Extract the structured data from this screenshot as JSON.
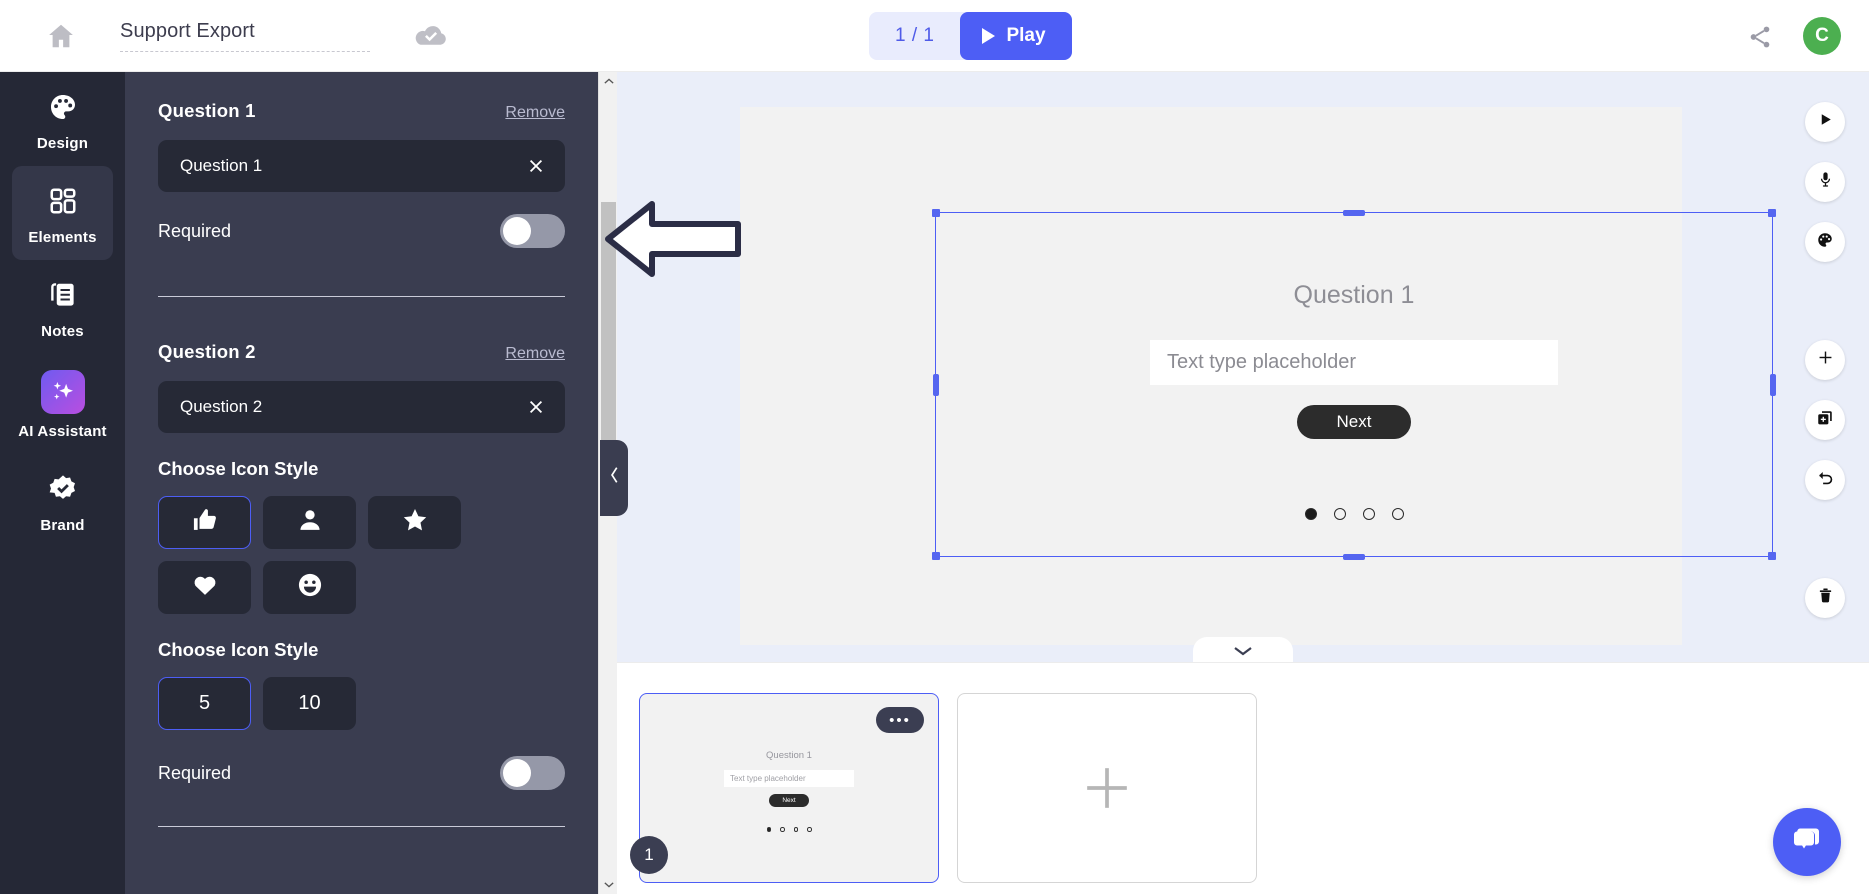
{
  "topbar": {
    "home_icon": "home-icon",
    "doc_title": "Support Export",
    "doc_title_placeholder": "Untitled",
    "save_status_icon": "cloud-check-icon",
    "page_count": "1 / 1",
    "play_label": "Play",
    "share_icon": "share-icon",
    "avatar_initial": "C",
    "avatar_color": "#4caf50",
    "accent_color": "#4d5ef5"
  },
  "rail": {
    "items": [
      {
        "label": "Design",
        "icon": "palette-icon",
        "active": false
      },
      {
        "label": "Elements",
        "icon": "grid-blocks-icon",
        "active": true
      },
      {
        "label": "Notes",
        "icon": "notes-icon",
        "active": false
      },
      {
        "label": "AI Assistant",
        "icon": "sparkles-icon",
        "active": false
      },
      {
        "label": "Brand",
        "icon": "verified-badge-icon",
        "active": false
      }
    ]
  },
  "panel": {
    "question1": {
      "title": "Question 1",
      "remove_label": "Remove",
      "field_value": "Question 1",
      "field_placeholder": "Question 1",
      "clear_icon": "close-icon",
      "required_label": "Required",
      "required_on": false
    },
    "question2": {
      "title": "Question 2",
      "remove_label": "Remove",
      "field_value": "Question 2",
      "field_placeholder": "Question 2",
      "clear_icon": "close-icon",
      "required_label": "Required",
      "required_on": false
    },
    "icon_style_section": {
      "title": "Choose Icon Style",
      "options": [
        {
          "icon": "thumbs-up-icon",
          "selected": true
        },
        {
          "icon": "person-icon",
          "selected": false
        },
        {
          "icon": "star-icon",
          "selected": false
        },
        {
          "icon": "heart-icon",
          "selected": false
        },
        {
          "icon": "smiley-face-icon",
          "selected": false
        }
      ]
    },
    "scale_section": {
      "title": "Choose Icon Style",
      "options": [
        {
          "label": "5",
          "selected": true
        },
        {
          "label": "10",
          "selected": false
        }
      ]
    },
    "scrollbar": {
      "up_icon": "chevron-up-icon",
      "down_icon": "chevron-down-icon"
    },
    "collapse_tab_icon": "chevron-left-icon"
  },
  "canvas": {
    "question_label": "Question 1",
    "input_placeholder": "Text type placeholder",
    "next_label": "Next",
    "dots": [
      true,
      false,
      false,
      false
    ],
    "selection_color": "#4d5ef5",
    "bottom_pill_icon": "chevron-down-icon",
    "tools": [
      {
        "icon": "play-icon",
        "group": 1
      },
      {
        "icon": "microphone-icon",
        "group": 1
      },
      {
        "icon": "palette-icon",
        "group": 1
      },
      {
        "icon": "plus-icon",
        "group": 2
      },
      {
        "icon": "duplicate-slide-icon",
        "group": 2
      },
      {
        "icon": "undo-icon",
        "group": 2
      },
      {
        "icon": "trash-icon",
        "group": 3
      }
    ]
  },
  "filmstrip": {
    "slides": [
      {
        "number": "1",
        "selected": true,
        "menu_icon": "ellipsis-icon",
        "menu_label": "•••",
        "question_label": "Question 1",
        "input_placeholder": "Text type placeholder",
        "next_label": "Next",
        "dots": [
          true,
          false,
          false,
          false
        ]
      }
    ],
    "add_slide_icon": "plus-icon"
  },
  "chat": {
    "icon": "chat-bubbles-icon"
  },
  "annotation": {
    "arrow": "left-pointing-arrow"
  }
}
